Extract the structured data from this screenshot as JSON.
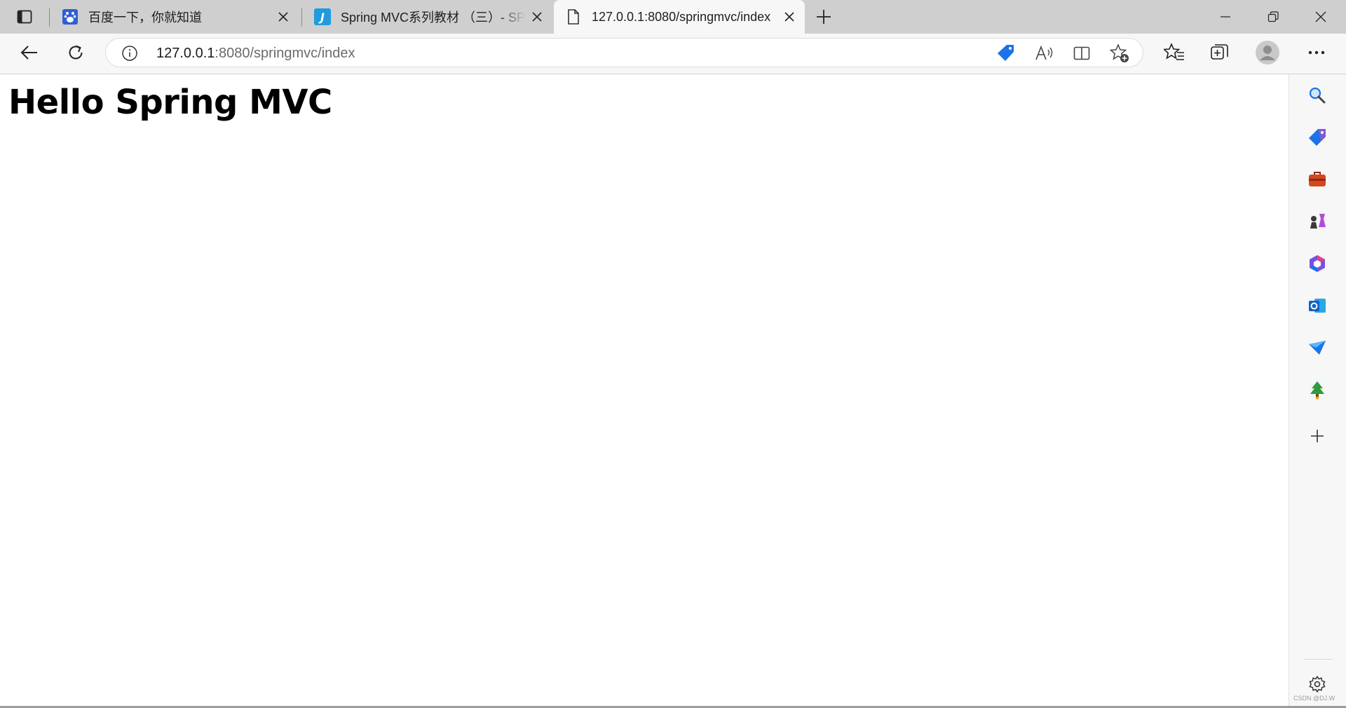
{
  "tabs": [
    {
      "title": "百度一下，你就知道",
      "favicon": "baidu-paw-icon",
      "active": false
    },
    {
      "title": "Spring MVC系列教材 （三）- SPRING",
      "favicon": "j-logo-icon",
      "active": false
    },
    {
      "title": "127.0.0.1:8080/springmvc/index",
      "favicon": "page-icon",
      "active": true
    }
  ],
  "address_bar": {
    "host": "127.0.0.1",
    "rest": ":8080/springmvc/index"
  },
  "page": {
    "heading": "Hello Spring MVC"
  },
  "watermark": "CSDN @DJ.W",
  "colors": {
    "tabstrip": "#cfcfcf",
    "toolbar": "#f7f7f7",
    "accent_blue": "#1a73e8",
    "text": "#1f1f1f"
  },
  "icons": {
    "toolbar": [
      "back-icon",
      "refresh-icon",
      "info-icon",
      "coupon-tag-icon",
      "read-aloud-icon",
      "split-screen-icon",
      "add-favorite-icon",
      "favorites-icon",
      "collections-icon",
      "profile-avatar-icon",
      "more-icon"
    ],
    "sidebar": [
      "search-icon",
      "shopping-tag-icon",
      "tools-briefcase-icon",
      "games-icon",
      "office-icon",
      "outlook-icon",
      "drop-icon",
      "tree-icon",
      "add-icon",
      "settings-icon"
    ]
  }
}
